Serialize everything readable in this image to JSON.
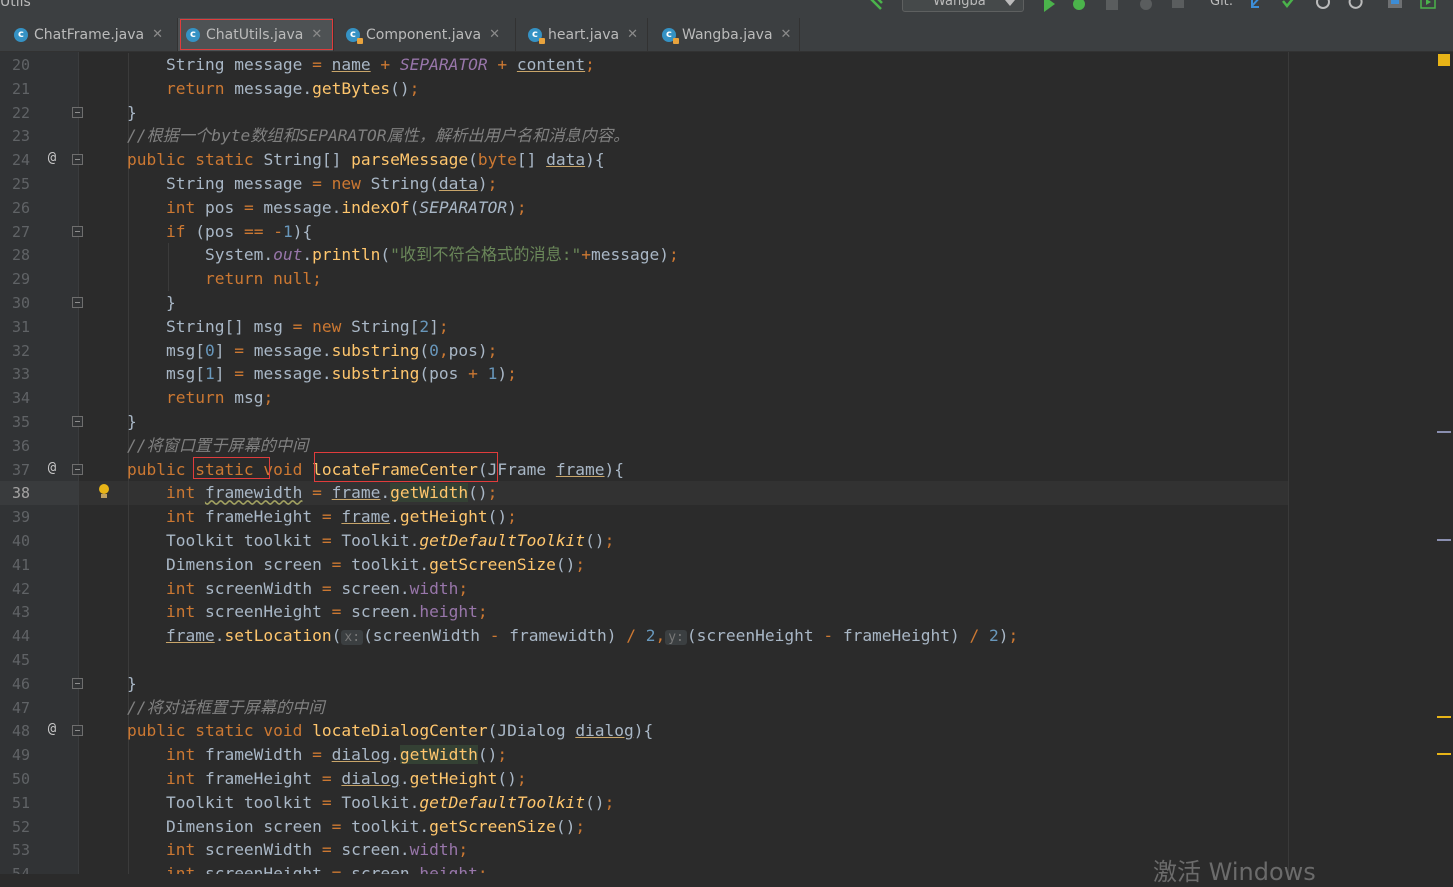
{
  "toolbar": {
    "project_label": "Utils",
    "run_config": "Wangba",
    "git_label": "Git:"
  },
  "tabs": [
    {
      "label": "ChatFrame.java",
      "active": false
    },
    {
      "label": "ChatUtils.java",
      "active": true
    },
    {
      "label": "Component.java",
      "active": false
    },
    {
      "label": "heart.java",
      "active": false
    },
    {
      "label": "Wangba.java",
      "active": false
    }
  ],
  "editor": {
    "current_line": 38,
    "lines": [
      {
        "n": 20,
        "html": [
          [
            "",
            "        "
          ],
          [
            "ty",
            "String"
          ],
          [
            "",
            " message "
          ],
          [
            "kw",
            "="
          ],
          [
            "",
            " "
          ],
          [
            "ul prm",
            "name"
          ],
          [
            "",
            " "
          ],
          [
            "kw",
            "+"
          ],
          [
            "",
            " "
          ],
          [
            "pri st",
            "SEPARATOR"
          ],
          [
            "",
            " "
          ],
          [
            "kw",
            "+"
          ],
          [
            "",
            " "
          ],
          [
            "ul prm",
            "content"
          ],
          [
            "kw",
            ";"
          ]
        ]
      },
      {
        "n": 21,
        "html": [
          [
            "",
            "        "
          ],
          [
            "kw",
            "return"
          ],
          [
            "",
            " message."
          ],
          [
            "fn",
            "getBytes"
          ],
          [
            "",
            "()"
          ],
          [
            "kw",
            ";"
          ]
        ]
      },
      {
        "n": 22,
        "html": [
          [
            "",
            "    }"
          ]
        ]
      },
      {
        "n": 23,
        "html": [
          [
            "",
            "    "
          ],
          [
            "cmt",
            "//根据一个byte数组和SEPARATOR属性，解析出用户名和消息内容。"
          ]
        ]
      },
      {
        "n": 24,
        "html": [
          [
            "",
            "    "
          ],
          [
            "kw",
            "public static "
          ],
          [
            "",
            "String[] "
          ],
          [
            "fn",
            "parseMessage"
          ],
          [
            "",
            "("
          ],
          [
            "kw",
            "byte"
          ],
          [
            "",
            "[] "
          ],
          [
            "ul prm",
            "data"
          ],
          [
            "",
            "){"
          ]
        ]
      },
      {
        "n": 25,
        "html": [
          [
            "",
            "        String message "
          ],
          [
            "kw",
            "="
          ],
          [
            "",
            " "
          ],
          [
            "kw",
            "new "
          ],
          [
            "",
            "String("
          ],
          [
            "ul prm",
            "data"
          ],
          [
            "",
            ")"
          ],
          [
            "kw",
            ";"
          ]
        ]
      },
      {
        "n": 26,
        "html": [
          [
            "",
            "        "
          ],
          [
            "kw",
            "int "
          ],
          [
            "",
            "pos "
          ],
          [
            "kw",
            "="
          ],
          [
            "",
            " message."
          ],
          [
            "fn",
            "indexOf"
          ],
          [
            "",
            "("
          ],
          [
            "st",
            "SEPARATOR"
          ],
          [
            "",
            ")"
          ],
          [
            "kw",
            ";"
          ]
        ]
      },
      {
        "n": 27,
        "html": [
          [
            "",
            "        "
          ],
          [
            "kw",
            "if "
          ],
          [
            "",
            "(pos "
          ],
          [
            "kw",
            "=="
          ],
          [
            "",
            " "
          ],
          [
            "kw",
            "-"
          ],
          [
            "num",
            "1"
          ],
          [
            "",
            "){"
          ]
        ]
      },
      {
        "n": 28,
        "html": [
          [
            "",
            "            System."
          ],
          [
            "pri",
            "out"
          ],
          [
            "",
            "."
          ],
          [
            "fn",
            "println"
          ],
          [
            "",
            "("
          ],
          [
            "str",
            "\"收到不符合格式的消息:\""
          ],
          [
            "kw",
            "+"
          ],
          [
            "",
            "message)"
          ],
          [
            "kw",
            ";"
          ]
        ]
      },
      {
        "n": 29,
        "html": [
          [
            "",
            "            "
          ],
          [
            "kw",
            "return null;"
          ]
        ]
      },
      {
        "n": 30,
        "html": [
          [
            "",
            "        }"
          ]
        ]
      },
      {
        "n": 31,
        "html": [
          [
            "",
            "        String[] msg "
          ],
          [
            "kw",
            "="
          ],
          [
            "",
            " "
          ],
          [
            "kw",
            "new "
          ],
          [
            "",
            "String["
          ],
          [
            "num",
            "2"
          ],
          [
            "",
            "]"
          ],
          [
            "kw",
            ";"
          ]
        ]
      },
      {
        "n": 32,
        "html": [
          [
            "",
            "        msg["
          ],
          [
            "num",
            "0"
          ],
          [
            "",
            "] "
          ],
          [
            "kw",
            "="
          ],
          [
            "",
            " message."
          ],
          [
            "fn",
            "substring"
          ],
          [
            "",
            "("
          ],
          [
            "num",
            "0"
          ],
          [
            "kw",
            ","
          ],
          [
            "",
            "pos)"
          ],
          [
            "kw",
            ";"
          ]
        ]
      },
      {
        "n": 33,
        "html": [
          [
            "",
            "        msg["
          ],
          [
            "num",
            "1"
          ],
          [
            "",
            "] "
          ],
          [
            "kw",
            "="
          ],
          [
            "",
            " message."
          ],
          [
            "fn",
            "substring"
          ],
          [
            "",
            "(pos "
          ],
          [
            "kw",
            "+"
          ],
          [
            "",
            " "
          ],
          [
            "num",
            "1"
          ],
          [
            "",
            ")"
          ],
          [
            "kw",
            ";"
          ]
        ]
      },
      {
        "n": 34,
        "html": [
          [
            "",
            "        "
          ],
          [
            "kw",
            "return "
          ],
          [
            "",
            "msg"
          ],
          [
            "kw",
            ";"
          ]
        ]
      },
      {
        "n": 35,
        "html": [
          [
            "",
            "    }"
          ]
        ]
      },
      {
        "n": 36,
        "html": [
          [
            "",
            "    "
          ],
          [
            "cmt",
            "//将窗口置于屏幕的中间"
          ]
        ]
      },
      {
        "n": 37,
        "html": [
          [
            "",
            "    "
          ],
          [
            "kw",
            "public static void "
          ],
          [
            "fn",
            "locateFrameCenter"
          ],
          [
            "",
            "(JFrame "
          ],
          [
            "ul prm",
            "frame"
          ],
          [
            "",
            "){"
          ]
        ]
      },
      {
        "n": 38,
        "html": [
          [
            "",
            "        "
          ],
          [
            "kw",
            "int "
          ],
          [
            "wavy",
            "framewidth"
          ],
          [
            "",
            " "
          ],
          [
            "kw",
            "="
          ],
          [
            "",
            " "
          ],
          [
            "ul prm",
            "frame"
          ],
          [
            "",
            "."
          ],
          [
            "fn hlsel",
            "getWidth"
          ],
          [
            "",
            "()"
          ],
          [
            "kw",
            ";"
          ]
        ]
      },
      {
        "n": 39,
        "html": [
          [
            "",
            "        "
          ],
          [
            "kw",
            "int "
          ],
          [
            "",
            "frameHeight "
          ],
          [
            "kw",
            "="
          ],
          [
            "",
            " "
          ],
          [
            "ul prm",
            "frame"
          ],
          [
            "",
            "."
          ],
          [
            "fn",
            "getHeight"
          ],
          [
            "",
            "()"
          ],
          [
            "kw",
            ";"
          ]
        ]
      },
      {
        "n": 40,
        "html": [
          [
            "",
            "        Toolkit toolkit "
          ],
          [
            "kw",
            "="
          ],
          [
            "",
            " Toolkit."
          ],
          [
            "fn st",
            "getDefaultToolkit"
          ],
          [
            "",
            "()"
          ],
          [
            "kw",
            ";"
          ]
        ]
      },
      {
        "n": 41,
        "html": [
          [
            "",
            "        Dimension screen "
          ],
          [
            "kw",
            "="
          ],
          [
            "",
            " toolkit."
          ],
          [
            "fn",
            "getScreenSize"
          ],
          [
            "",
            "()"
          ],
          [
            "kw",
            ";"
          ]
        ]
      },
      {
        "n": 42,
        "html": [
          [
            "",
            "        "
          ],
          [
            "kw",
            "int "
          ],
          [
            "",
            "screenWidth "
          ],
          [
            "kw",
            "="
          ],
          [
            "",
            " screen."
          ],
          [
            "pr",
            "width"
          ],
          [
            "kw",
            ";"
          ]
        ]
      },
      {
        "n": 43,
        "html": [
          [
            "",
            "        "
          ],
          [
            "kw",
            "int "
          ],
          [
            "",
            "screenHeight "
          ],
          [
            "kw",
            "="
          ],
          [
            "",
            " screen."
          ],
          [
            "pr",
            "height"
          ],
          [
            "kw",
            ";"
          ]
        ]
      },
      {
        "n": 44,
        "html": [
          [
            "",
            "        "
          ],
          [
            "ul prm",
            "frame"
          ],
          [
            "",
            "."
          ],
          [
            "fn",
            "setLocation"
          ],
          [
            "",
            "("
          ],
          [
            "hint",
            "x:"
          ],
          [
            "",
            "(screenWidth "
          ],
          [
            "kw",
            "-"
          ],
          [
            "",
            " framewidth) "
          ],
          [
            "kw",
            "/"
          ],
          [
            "",
            " "
          ],
          [
            "num",
            "2"
          ],
          [
            "kw",
            ","
          ],
          [
            "hint",
            "y:"
          ],
          [
            "",
            "(screenHeight "
          ],
          [
            "kw",
            "-"
          ],
          [
            "",
            " frameHeight) "
          ],
          [
            "kw",
            "/"
          ],
          [
            "",
            " "
          ],
          [
            "num",
            "2"
          ],
          [
            "",
            ")"
          ],
          [
            "kw",
            ";"
          ]
        ]
      },
      {
        "n": 45,
        "html": [
          [
            "",
            ""
          ]
        ]
      },
      {
        "n": 46,
        "html": [
          [
            "",
            "    }"
          ]
        ]
      },
      {
        "n": 47,
        "html": [
          [
            "",
            "    "
          ],
          [
            "cmt",
            "//将对话框置于屏幕的中间"
          ]
        ]
      },
      {
        "n": 48,
        "html": [
          [
            "",
            "    "
          ],
          [
            "kw",
            "public static void "
          ],
          [
            "fn",
            "locateDialogCenter"
          ],
          [
            "",
            "(JDialog "
          ],
          [
            "ul prm",
            "dialog"
          ],
          [
            "",
            "){"
          ]
        ]
      },
      {
        "n": 49,
        "html": [
          [
            "",
            "        "
          ],
          [
            "kw",
            "int "
          ],
          [
            "",
            "frameWidth "
          ],
          [
            "kw",
            "="
          ],
          [
            "",
            " "
          ],
          [
            "ul prm",
            "dialog"
          ],
          [
            "",
            "."
          ],
          [
            "fn hlsel",
            "getWidth"
          ],
          [
            "",
            "()"
          ],
          [
            "kw",
            ";"
          ]
        ]
      },
      {
        "n": 50,
        "html": [
          [
            "",
            "        "
          ],
          [
            "kw",
            "int "
          ],
          [
            "",
            "frameHeight "
          ],
          [
            "kw",
            "="
          ],
          [
            "",
            " "
          ],
          [
            "ul prm",
            "dialog"
          ],
          [
            "",
            "."
          ],
          [
            "fn",
            "getHeight"
          ],
          [
            "",
            "()"
          ],
          [
            "kw",
            ";"
          ]
        ]
      },
      {
        "n": 51,
        "html": [
          [
            "",
            "        Toolkit toolkit "
          ],
          [
            "kw",
            "="
          ],
          [
            "",
            " Toolkit."
          ],
          [
            "fn st",
            "getDefaultToolkit"
          ],
          [
            "",
            "()"
          ],
          [
            "kw",
            ";"
          ]
        ]
      },
      {
        "n": 52,
        "html": [
          [
            "",
            "        Dimension screen "
          ],
          [
            "kw",
            "="
          ],
          [
            "",
            " toolkit."
          ],
          [
            "fn",
            "getScreenSize"
          ],
          [
            "",
            "()"
          ],
          [
            "kw",
            ";"
          ]
        ]
      },
      {
        "n": 53,
        "html": [
          [
            "",
            "        "
          ],
          [
            "kw",
            "int "
          ],
          [
            "",
            "screenWidth "
          ],
          [
            "kw",
            "="
          ],
          [
            "",
            " screen."
          ],
          [
            "pr",
            "width"
          ],
          [
            "kw",
            ";"
          ]
        ]
      },
      {
        "n": 54,
        "html": [
          [
            "",
            "        "
          ],
          [
            "kw",
            "int "
          ],
          [
            "",
            "screenHeight "
          ],
          [
            "kw",
            "="
          ],
          [
            "",
            " screen."
          ],
          [
            "pr",
            "height"
          ],
          [
            "kw",
            ";"
          ]
        ]
      }
    ],
    "annotations": {
      "24": "@",
      "37": "@",
      "48": "@"
    },
    "fold_lines": [
      22,
      24,
      27,
      30,
      35,
      37,
      46,
      48
    ]
  },
  "watermark": "激活 Windows",
  "colors": {
    "background": "#2b2b2b",
    "keyword": "#cc7832",
    "method": "#ffc66d",
    "field": "#9876aa",
    "number": "#6897bb",
    "string": "#6a8759",
    "comment": "#808080",
    "warning_marker": "#e8b417",
    "tab_icon": "#3592c4"
  }
}
